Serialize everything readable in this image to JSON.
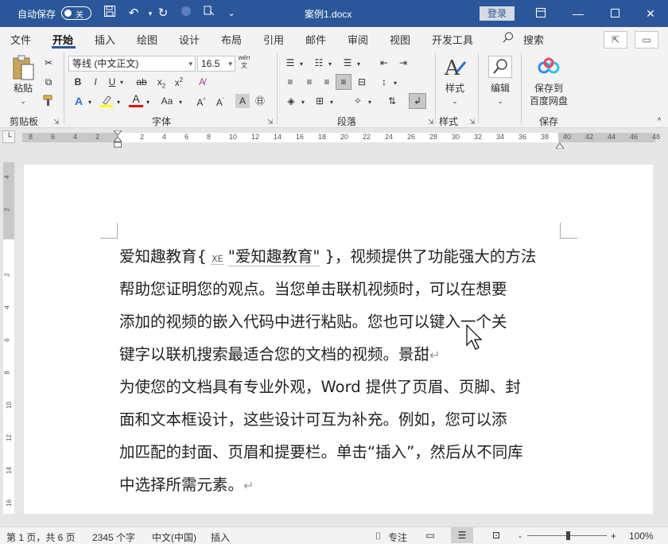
{
  "titlebar": {
    "autosave_label": "自动保存",
    "autosave_state": "关",
    "doc_title": "案例1.docx",
    "login_label": "登录"
  },
  "tabs": [
    {
      "label": "文件"
    },
    {
      "label": "开始"
    },
    {
      "label": "插入"
    },
    {
      "label": "绘图"
    },
    {
      "label": "设计"
    },
    {
      "label": "布局"
    },
    {
      "label": "引用"
    },
    {
      "label": "邮件"
    },
    {
      "label": "审阅"
    },
    {
      "label": "视图"
    },
    {
      "label": "开发工具"
    },
    {
      "label": "搜索"
    }
  ],
  "ribbon": {
    "paste_label": "粘贴",
    "font_name": "等线 (中文正文)",
    "font_size": "16.5",
    "styles_label": "样式",
    "edit_label": "编辑",
    "save_baidu_label1": "保存到",
    "save_baidu_label2": "百度网盘",
    "groups": {
      "clipboard": "剪贴板",
      "font": "字体",
      "paragraph": "段落",
      "styles": "样式",
      "save": "保存"
    }
  },
  "ruler": {
    "ticks": [
      "8",
      "6",
      "4",
      "2",
      "2",
      "4",
      "6",
      "8",
      "10",
      "12",
      "14",
      "16",
      "18",
      "20",
      "22",
      "24",
      "26",
      "28",
      "30",
      "32",
      "34",
      "36",
      "38",
      "40",
      "42",
      "44",
      "46",
      "48"
    ]
  },
  "document": {
    "lines": [
      {
        "before": "爱知趣教育",
        "field_open": "{",
        "xe": "XE",
        "field_text": "\"爱知趣教育\"",
        "field_close": "}",
        "after": "，视频提供了功能强大的方法"
      },
      {
        "text": "帮助您证明您的观点。当您单击联机视频时，可以在想要"
      },
      {
        "text": "添加的视频的嵌入代码中进行粘贴。您也可以键入一个关"
      },
      {
        "text": "键字以联机搜索最适合您的文档的视频。景甜",
        "mark": "↵"
      },
      {
        "text": "为使您的文档具有专业外观，Word 提供了页眉、页脚、封"
      },
      {
        "text": "面和文本框设计，这些设计可互为补充。例如，您可以添"
      },
      {
        "text": "加匹配的封面、页眉和提要栏。单击“插入”，然后从不同库"
      },
      {
        "text": "中选择所需元素。",
        "mark": "↵"
      }
    ]
  },
  "statusbar": {
    "page": "第 1 页，共 6 页",
    "words": "2345 个字",
    "language": "中文(中国)",
    "mode": "插入",
    "focus": "专注",
    "zoom": "100%",
    "zoom_minus": "-",
    "zoom_plus": "+"
  }
}
